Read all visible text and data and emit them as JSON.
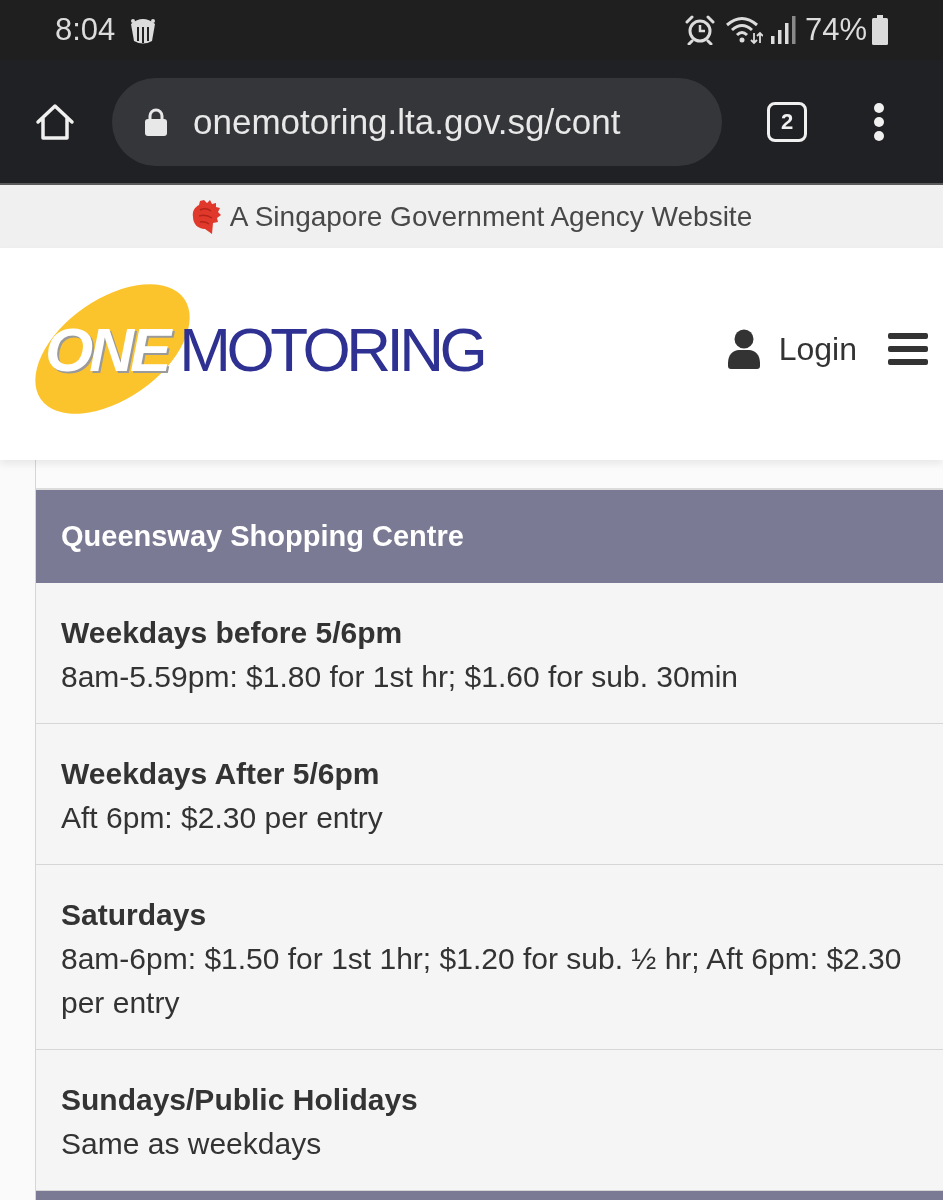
{
  "status_bar": {
    "time": "8:04",
    "battery": "74%"
  },
  "browser": {
    "url": "onemotoring.lta.gov.sg/cont",
    "tab_count": "2"
  },
  "gov_banner": {
    "text": "A Singapore Government Agency Website"
  },
  "header": {
    "logo": {
      "emblem_text": "ONE",
      "wordmark_text": "MOTORING"
    },
    "login": "Login"
  },
  "table": {
    "title": "Queensway Shopping Centre",
    "rows": [
      {
        "heading": "Weekdays before 5/6pm",
        "detail": "8am-5.59pm: $1.80 for 1st hr; $1.60 for sub. 30min"
      },
      {
        "heading": "Weekdays After 5/6pm",
        "detail": "Aft 6pm: $2.30 per entry"
      },
      {
        "heading": "Saturdays",
        "detail": "8am-6pm: $1.50 for 1st 1hr; $1.20 for sub. ½ hr; Aft 6pm: $2.30 per entry"
      },
      {
        "heading": "Sundays/Public Holidays",
        "detail": "Same as weekdays"
      }
    ]
  }
}
